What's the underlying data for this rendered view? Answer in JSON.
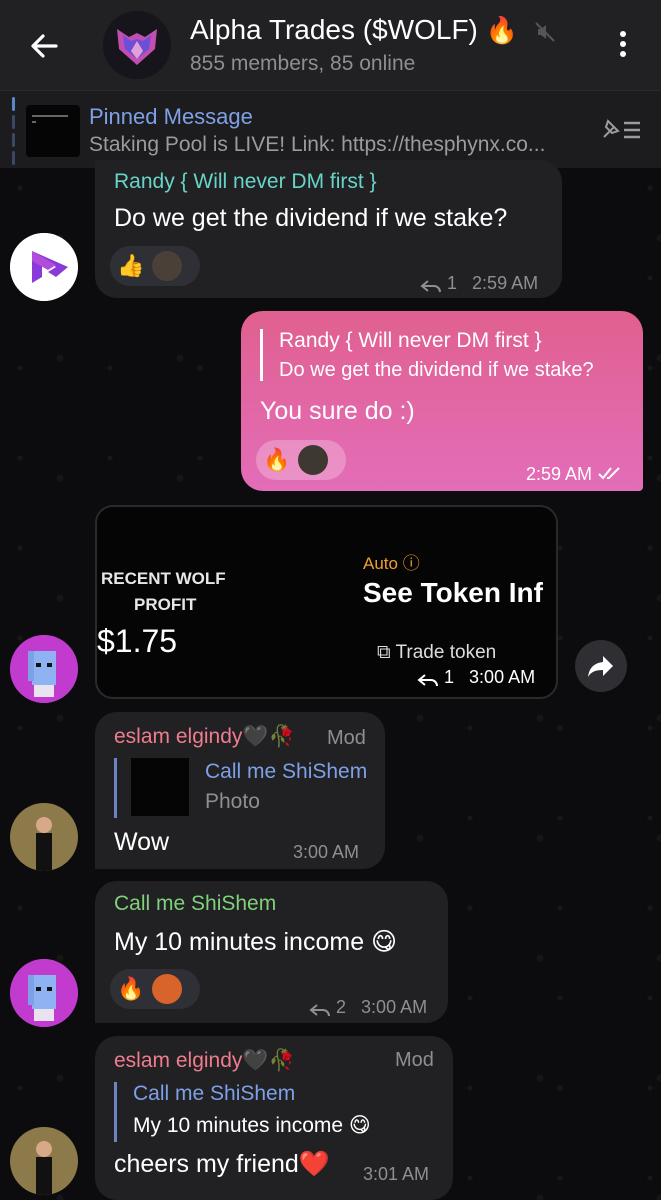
{
  "header": {
    "title": "Alpha Trades ($WOLF)",
    "title_emoji": "🔥",
    "subtitle": "855 members, 85 online"
  },
  "pinned": {
    "title": "Pinned Message",
    "text": "Staking Pool is LIVE!   Link: https://thesphynx.co..."
  },
  "messages": [
    {
      "sender": "Randy { Will never DM first }",
      "text": "Do we get the dividend if we stake?",
      "reactions": [
        "👍"
      ],
      "replies": "1",
      "time": "2:59 AM"
    },
    {
      "quote_sender": "Randy { Will never DM first }",
      "quote_text": "Do we get the dividend if we stake?",
      "text": "You sure do :)",
      "reactions": [
        "🔥"
      ],
      "time": "2:59 AM"
    },
    {
      "card": {
        "left_label_1": "RECENT WOLF",
        "left_label_2": "PROFIT",
        "amount": "$1.75",
        "auto": "Auto",
        "headline": "See Token Inf",
        "link": "Trade token"
      },
      "replies": "1",
      "time": "3:00 AM"
    },
    {
      "sender": "eslam elgindy🖤🥀",
      "badge": "Mod",
      "quote_sender": "Call me ShiShem",
      "quote_text": "Photo",
      "text": "Wow",
      "time": "3:00 AM"
    },
    {
      "sender": "Call me ShiShem",
      "text": "My 10 minutes income 😋",
      "reactions": [
        "🔥"
      ],
      "replies": "2",
      "time": "3:00 AM"
    },
    {
      "sender": "eslam elgindy🖤🥀",
      "badge": "Mod",
      "quote_sender": "Call me ShiShem",
      "quote_text": "My 10 minutes income 😋",
      "text": "cheers my friend❤️",
      "time": "3:01 AM"
    }
  ],
  "colors": {
    "header_bg": "#212124",
    "bubble_in": "#212123",
    "bubble_out_start": "#e0608f",
    "bubble_out_end": "#e36db9",
    "name_randy": "#68d4c8",
    "name_eslam": "#ef7c8e",
    "name_shishem": "#7fd17b",
    "link_blue": "#7ea0e6"
  }
}
